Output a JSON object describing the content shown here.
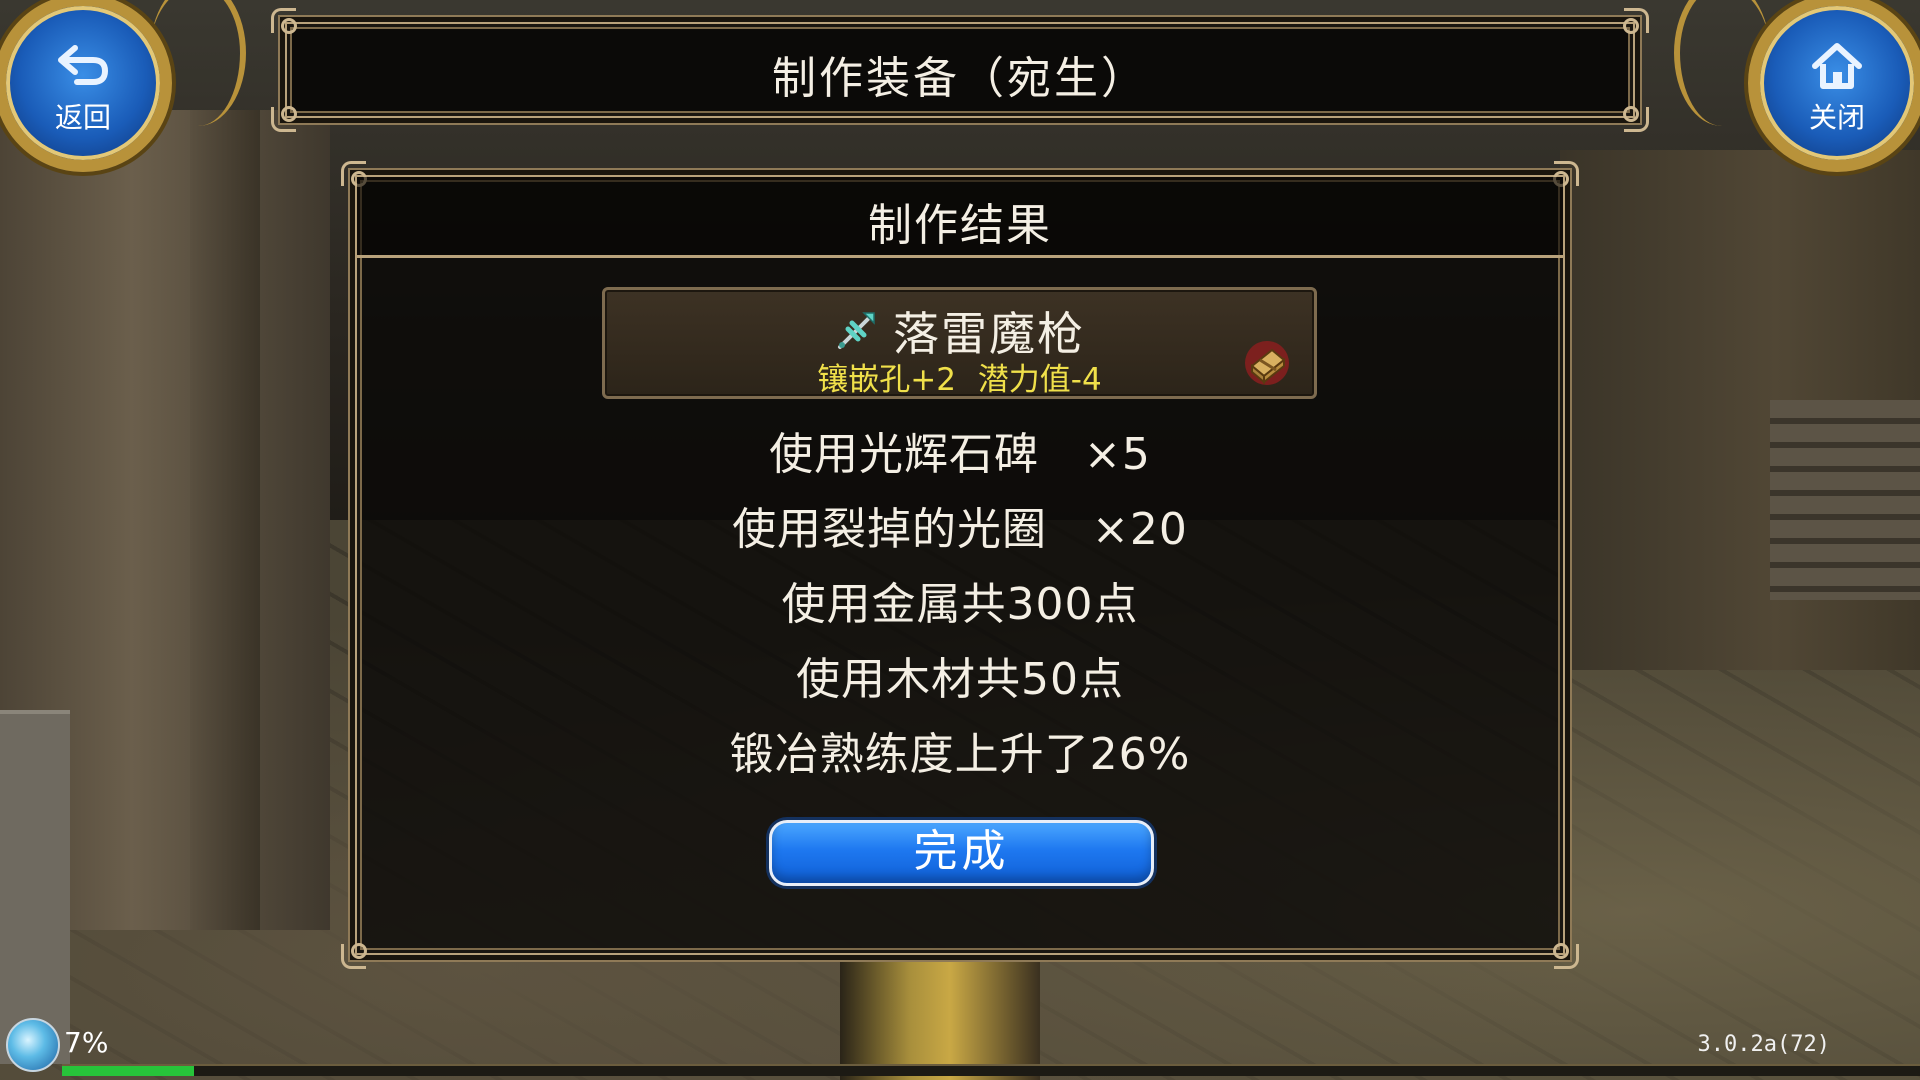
{
  "header": {
    "title": "制作装备（宛生）"
  },
  "nav": {
    "back_label": "返回",
    "close_label": "关闭"
  },
  "dialog": {
    "title": "制作结果",
    "item": {
      "name": "落雷魔枪",
      "stats": [
        "镶嵌孔+2",
        "潜力值-4"
      ],
      "icon": "spear-icon",
      "material_icon": "treasure-box-icon"
    },
    "lines": [
      "使用光辉石碑　×5",
      "使用裂掉的光圈　×20",
      "使用金属共300点",
      "使用木材共50点",
      "锻冶熟练度上升了26%"
    ],
    "done_label": "完成"
  },
  "hud": {
    "exp_text": "7%",
    "exp_progress": 0.07,
    "version": "3.0.2a(72)"
  },
  "colors": {
    "accent_blue": "#1e78f0",
    "stat_yellow": "#f0e04a",
    "frame_gold": "#b9a27b",
    "exp_green": "#27c43a"
  }
}
